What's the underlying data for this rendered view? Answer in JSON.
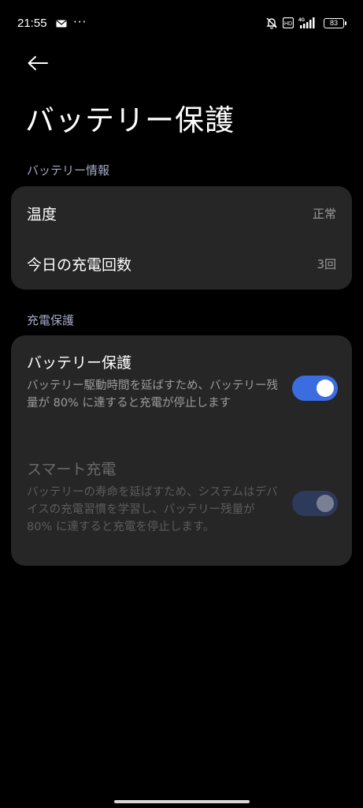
{
  "status_bar": {
    "time": "21:55",
    "more": "···",
    "network": "4G",
    "volte": "VoLTE",
    "battery": "83",
    "icons": [
      "mail-icon",
      "more-dots-icon",
      "mute-bell-icon",
      "volte-icon",
      "signal-icon",
      "battery-icon"
    ]
  },
  "header": {
    "back_icon": "back-arrow-icon",
    "title": "バッテリー保護"
  },
  "battery_info": {
    "section_title": "バッテリー情報",
    "rows": [
      {
        "label": "温度",
        "value": "正常"
      },
      {
        "label": "今日の充電回数",
        "value": "3回"
      }
    ]
  },
  "charge_protection": {
    "section_title": "充電保護",
    "items": [
      {
        "title": "バッテリー保護",
        "description": "バッテリー駆動時間を延ばすため、バッテリー残量が 80% に達すると充電が停止します",
        "enabled": true,
        "available": true
      },
      {
        "title": "スマート充電",
        "description": "バッテリーの寿命を延ばすため、システムはデバイスの充電習慣を学習し、バッテリー残量が 80% に達すると充電を停止します。",
        "enabled": true,
        "available": false
      }
    ]
  },
  "colors": {
    "background": "#000000",
    "card": "#262626",
    "accent": "#3b6de0",
    "section_header": "#a4aac6"
  }
}
